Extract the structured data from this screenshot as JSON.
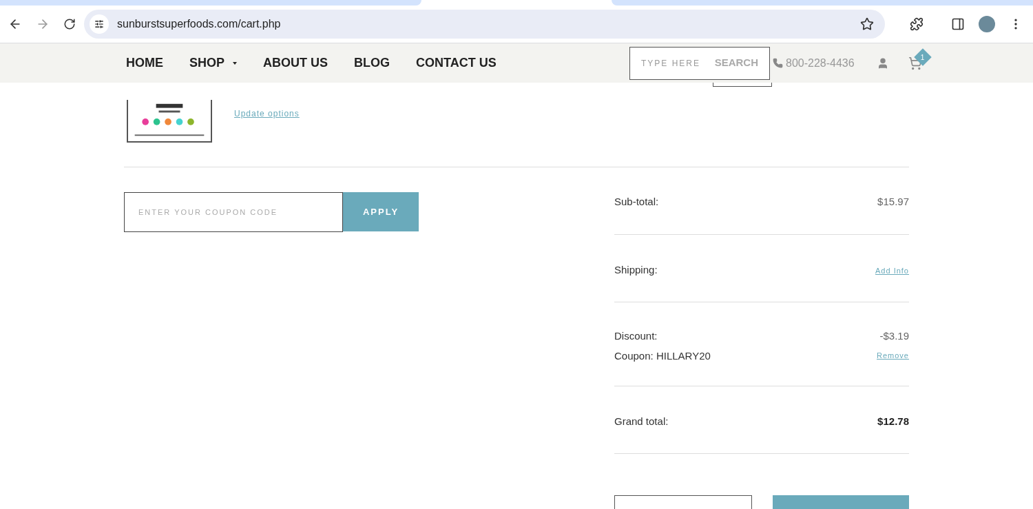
{
  "browser": {
    "url": "sunburstsuperfoods.com/cart.php"
  },
  "nav": {
    "items": [
      {
        "label": "HOME",
        "dropdown": false
      },
      {
        "label": "SHOP",
        "dropdown": true
      },
      {
        "label": "ABOUT US",
        "dropdown": false
      },
      {
        "label": "BLOG",
        "dropdown": false
      },
      {
        "label": "CONTACT US",
        "dropdown": false
      }
    ],
    "search": {
      "placeholder": "TYPE HERE",
      "button": "SEARCH"
    },
    "phone": "800-228-4436",
    "cart_count": "1"
  },
  "cart_item": {
    "link": "Update options"
  },
  "coupon": {
    "placeholder": "ENTER YOUR COUPON CODE",
    "button": "APPLY"
  },
  "totals": [
    {
      "label": "Sub-total:",
      "value": "$15.97",
      "kind": "amount"
    },
    {
      "label": "Shipping:",
      "value": "Add Info",
      "kind": "link"
    },
    {
      "label": "Discount:",
      "value": "-$3.19",
      "kind": "discount",
      "coupon": "Coupon: HILLARY20",
      "action": "Remove"
    },
    {
      "label": "Grand total:",
      "value": "$12.78",
      "kind": "total"
    }
  ]
}
